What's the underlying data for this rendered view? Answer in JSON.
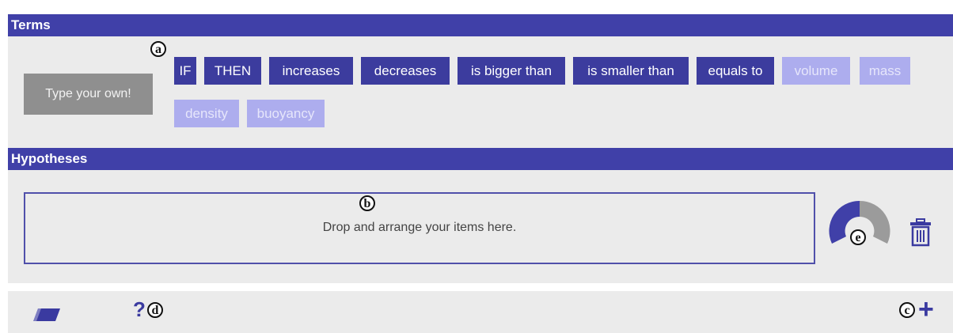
{
  "terms": {
    "header": "Terms",
    "type_own_label": "Type your own!",
    "operators": [
      "IF",
      "THEN",
      "increases",
      "decreases",
      "is bigger than",
      "is smaller than",
      "equals to"
    ],
    "variables": [
      "volume",
      "mass",
      "density",
      "buoyancy"
    ]
  },
  "hypotheses": {
    "header": "Hypotheses",
    "dropzone_text": "Drop and arrange your items here."
  },
  "gauge": {
    "filled_fraction": 0.5
  },
  "toolbar": {
    "help_label": "?",
    "add_label": "+"
  },
  "markers": {
    "a": "a",
    "b": "b",
    "c": "c",
    "d": "d",
    "e": "e"
  },
  "icons": {
    "eraser": "eraser-icon",
    "trash": "trash-icon",
    "plus": "plus-icon",
    "help": "help-icon"
  },
  "colors": {
    "header": "#4040a8",
    "operator_term": "#3c3c9e",
    "variable_term": "#adadee",
    "panel": "#ebebeb",
    "type_own": "#8f8f8f",
    "gauge_filled": "#4040a8",
    "gauge_empty": "#9b9b9b"
  }
}
